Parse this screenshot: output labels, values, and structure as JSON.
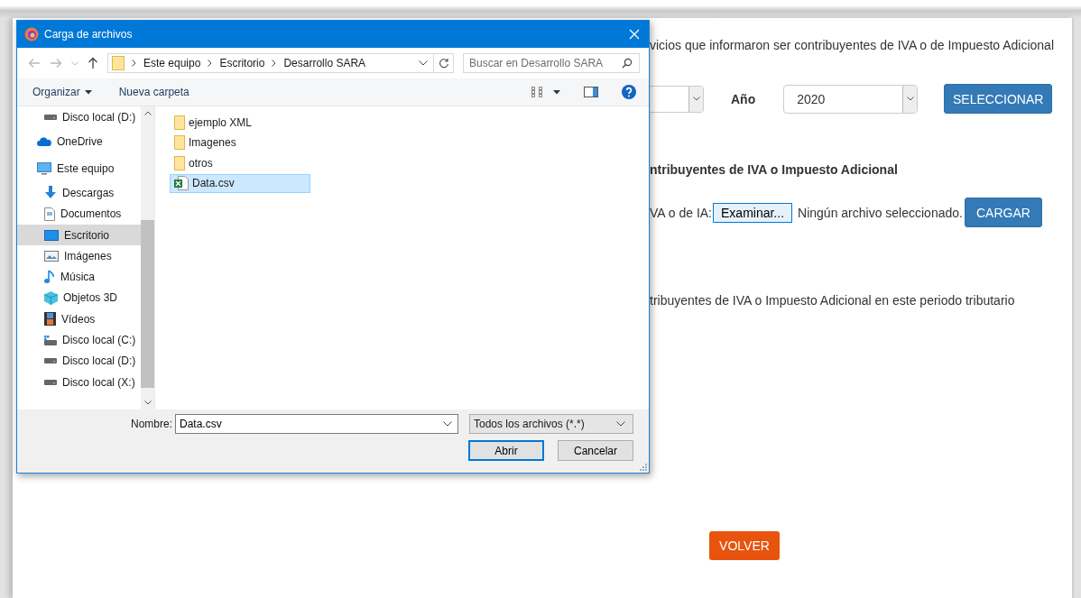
{
  "page": {
    "intro": "vicios que informaron ser contribuyentes de IVA o de Impuesto Adicional",
    "period": {
      "year_label": "Año",
      "year_value": "2020",
      "select_button": "SELECCIONAR"
    },
    "upload_heading": "ntribuyentes de IVA o Impuesto Adicional",
    "upload": {
      "label": "VA o de IA:",
      "browse_button": "Examinar...",
      "status": "Ningún archivo seleccionado.",
      "upload_button": "CARGAR"
    },
    "note": "tribuyentes de IVA o Impuesto Adicional en este periodo tributario",
    "back_button": "VOLVER"
  },
  "dialog": {
    "title": "Carga de archivos",
    "breadcrumb": [
      "Este equipo",
      "Escritorio",
      "Desarrollo SARA"
    ],
    "search": {
      "placeholder": "Buscar en Desarrollo SARA"
    },
    "toolbar": {
      "organize": "Organizar",
      "new_folder": "Nueva carpeta"
    },
    "sidebar": {
      "items": [
        {
          "children": [
            {
              "label": "Disco local (D:)",
              "kind": "drive",
              "selected": false
            }
          ]
        },
        {
          "label": "OneDrive",
          "kind": "cloud",
          "selected": false
        },
        {
          "label": "Este equipo",
          "kind": "computer",
          "selected": false,
          "children": [
            {
              "label": "Descargas",
              "kind": "download",
              "selected": false
            },
            {
              "label": "Documentos",
              "kind": "document",
              "selected": false
            },
            {
              "label": "Escritorio",
              "kind": "desktop",
              "selected": true
            },
            {
              "label": "Imágenes",
              "kind": "picture",
              "selected": false
            },
            {
              "label": "Música",
              "kind": "music",
              "selected": false
            },
            {
              "label": "Objetos 3D",
              "kind": "cube",
              "selected": false
            },
            {
              "label": "Vídeos",
              "kind": "video",
              "selected": false
            },
            {
              "label": "Disco local (C:)",
              "kind": "system-drive",
              "selected": false
            },
            {
              "label": "Disco local (D:)",
              "kind": "drive",
              "selected": false
            },
            {
              "label": "Disco local (X:)",
              "kind": "drive",
              "selected": false
            }
          ]
        }
      ]
    },
    "files": [
      {
        "name": "ejemplo XML",
        "kind": "folder",
        "selected": false
      },
      {
        "name": "Imagenes",
        "kind": "folder",
        "selected": false
      },
      {
        "name": "otros",
        "kind": "folder",
        "selected": false
      },
      {
        "name": "Data.csv",
        "kind": "spreadsheet",
        "selected": true
      }
    ],
    "filename": {
      "label": "Nombre:",
      "value": "Data.csv"
    },
    "filter": "Todos los archivos (*.*)",
    "buttons": [
      {
        "label": "Abrir",
        "default": true
      },
      {
        "label": "Cancelar",
        "default": false
      }
    ]
  }
}
